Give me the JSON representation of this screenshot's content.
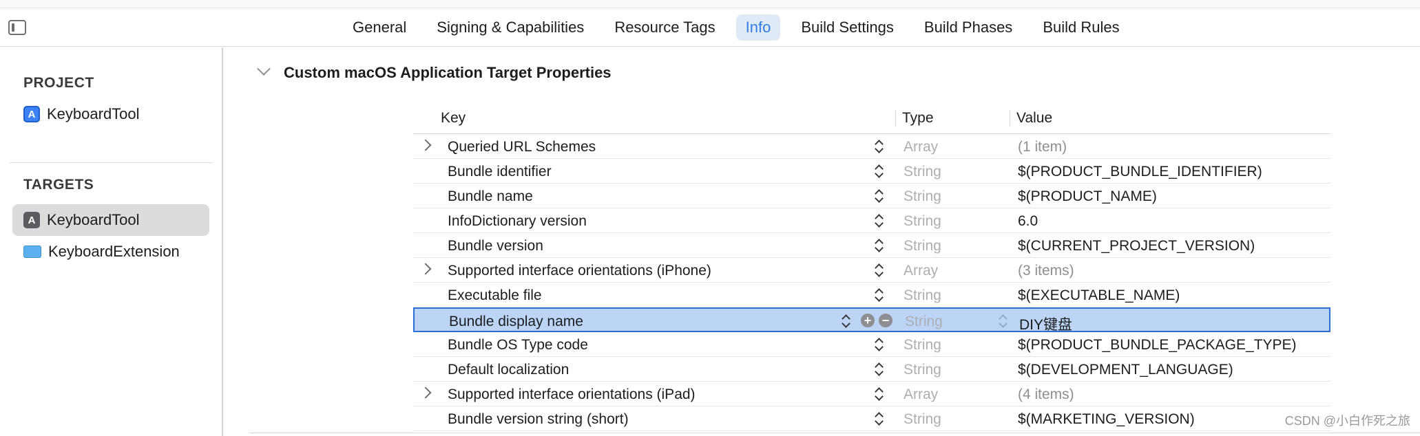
{
  "tabs": [
    {
      "label": "General",
      "active": false
    },
    {
      "label": "Signing & Capabilities",
      "active": false
    },
    {
      "label": "Resource Tags",
      "active": false
    },
    {
      "label": "Info",
      "active": true
    },
    {
      "label": "Build Settings",
      "active": false
    },
    {
      "label": "Build Phases",
      "active": false
    },
    {
      "label": "Build Rules",
      "active": false
    }
  ],
  "sidebar": {
    "project_title": "PROJECT",
    "project_item": "KeyboardTool",
    "targets_title": "TARGETS",
    "targets": [
      {
        "label": "KeyboardTool",
        "selected": true,
        "icon": "app-target-icon"
      },
      {
        "label": "KeyboardExtension",
        "selected": false,
        "icon": "keyboard-icon"
      }
    ]
  },
  "section": {
    "title": "Custom macOS Application Target Properties"
  },
  "table": {
    "headers": {
      "key": "Key",
      "type": "Type",
      "value": "Value"
    },
    "rows": [
      {
        "key": "Queried URL Schemes",
        "type": "Array",
        "value": "(1 item)",
        "expandable": true
      },
      {
        "key": "Bundle identifier",
        "type": "String",
        "value": "$(PRODUCT_BUNDLE_IDENTIFIER)",
        "expandable": false
      },
      {
        "key": "Bundle name",
        "type": "String",
        "value": "$(PRODUCT_NAME)",
        "expandable": false
      },
      {
        "key": "InfoDictionary version",
        "type": "String",
        "value": "6.0",
        "expandable": false
      },
      {
        "key": "Bundle version",
        "type": "String",
        "value": "$(CURRENT_PROJECT_VERSION)",
        "expandable": false
      },
      {
        "key": "Supported interface orientations (iPhone)",
        "type": "Array",
        "value": "(3 items)",
        "expandable": true
      },
      {
        "key": "Executable file",
        "type": "String",
        "value": "$(EXECUTABLE_NAME)",
        "expandable": false
      },
      {
        "key": "Bundle display name",
        "type": "String",
        "value": "DIY键盘",
        "expandable": false,
        "selected": true
      },
      {
        "key": "Bundle OS Type code",
        "type": "String",
        "value": "$(PRODUCT_BUNDLE_PACKAGE_TYPE)",
        "expandable": false
      },
      {
        "key": "Default localization",
        "type": "String",
        "value": "$(DEVELOPMENT_LANGUAGE)",
        "expandable": false
      },
      {
        "key": "Supported interface orientations (iPad)",
        "type": "Array",
        "value": "(4 items)",
        "expandable": true
      },
      {
        "key": "Bundle version string (short)",
        "type": "String",
        "value": "$(MARKETING_VERSION)",
        "expandable": false
      }
    ]
  },
  "watermark": "CSDN @小白作死之旅"
}
